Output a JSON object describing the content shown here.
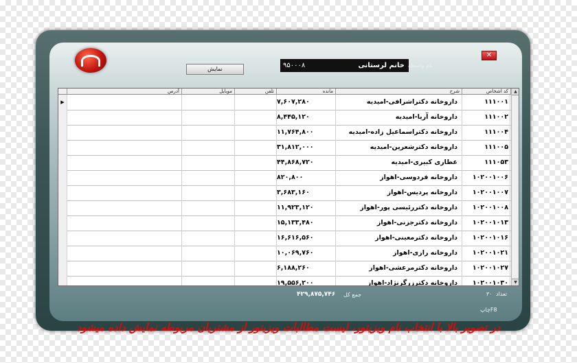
{
  "toolbar": {
    "show_label": "نمایش",
    "agent_label": "نام واسطه",
    "agent_name": "خانم لرستانی",
    "agent_code": "۹۵۰۰۰۸",
    "close_glyph": "✕"
  },
  "table": {
    "headers": {
      "code": "کد اشخاص",
      "desc": "شرح",
      "balance": "مانده",
      "tel": "تلفن",
      "mobile": "موبایل",
      "address": "آدرس"
    },
    "rows": [
      {
        "code": "۱۱۱۰۰۱",
        "desc": "داروخانه دکتراشرافی-امیدیه",
        "balance": "۷,۶۰۷,۲۸۰",
        "selected": true
      },
      {
        "code": "۱۱۱۰۰۲",
        "desc": "داروخانه آریا-امیدیه",
        "balance": "۸,۴۴۵,۱۲۰",
        "selected": false
      },
      {
        "code": "۱۱۱۰۰۴",
        "desc": "داروخانه دکتراسماعیل زاده-امیدیه",
        "balance": "۱۱,۷۶۴,۸۰۰",
        "selected": false
      },
      {
        "code": "۱۱۱۰۰۵",
        "desc": "داروخانه دکترشعرین-امیدیه",
        "balance": "۳۱,۸۱۲,۰۰۰",
        "selected": false
      },
      {
        "code": "۱۱۱۰۵۳",
        "desc": "عطاری کبیری-امیدیه",
        "balance": "۴۴,۸۶۸,۷۲۰",
        "selected": false
      },
      {
        "code": "۱۰۲۰۰۱۰۰۶",
        "desc": "داروخانه فردوسی-اهواز",
        "balance": "۸۲۰,۸۰۰",
        "selected": false
      },
      {
        "code": "۱۰۲۰۰۱۰۰۷",
        "desc": "داروخانه پردیس-اهواز",
        "balance": "۳,۶۸۳,۱۶۰",
        "selected": false
      },
      {
        "code": "۱۰۲۰۰۱۰۰۸",
        "desc": "داروخانه دکتررئیسی پور-اهواز",
        "balance": "۱۱,۹۲۳,۱۲۰",
        "selected": false
      },
      {
        "code": "۱۰۲۰۰۱۰۱۳",
        "desc": "داروخانه دکترجزنی-اهواز",
        "balance": "۱۵,۱۳۳,۴۸۰",
        "selected": false
      },
      {
        "code": "۱۰۲۰۰۱۰۱۶",
        "desc": "داروخانه دکترمعینی-اهواز",
        "balance": "۱۶,۶۱۶,۵۶۰",
        "selected": false
      },
      {
        "code": "۱۰۲۰۰۱۰۲۱",
        "desc": "داروخانه رازی-اهواز",
        "balance": "۱۰,۰۶۹,۷۶۰",
        "selected": false
      },
      {
        "code": "۱۰۲۰۰۱۰۲۷",
        "desc": "داروخانه دکترمرعشی-اهواز",
        "balance": "۶,۱۸۸,۲۶۰",
        "selected": false
      },
      {
        "code": "۱۰۲۰۰۱۰۳۰",
        "desc": "داروخانه دکترزرگرنژاد-اهواز",
        "balance": "۱۹,۵۵۶,۲۰۰",
        "selected": false
      }
    ]
  },
  "footer": {
    "count_label": "تعداد",
    "count_value": "۳۰",
    "total_label": "جمع کل",
    "total_value": "۴۲۹,۸۷۵,۷۴۶",
    "print_label": "F8چاپ"
  },
  "caption": "در تصویر بالا با انتخاب نام ویزیتور، لیست مطالبات ویزیتور از مشتریان مربوطه نمایش داده میشود"
}
